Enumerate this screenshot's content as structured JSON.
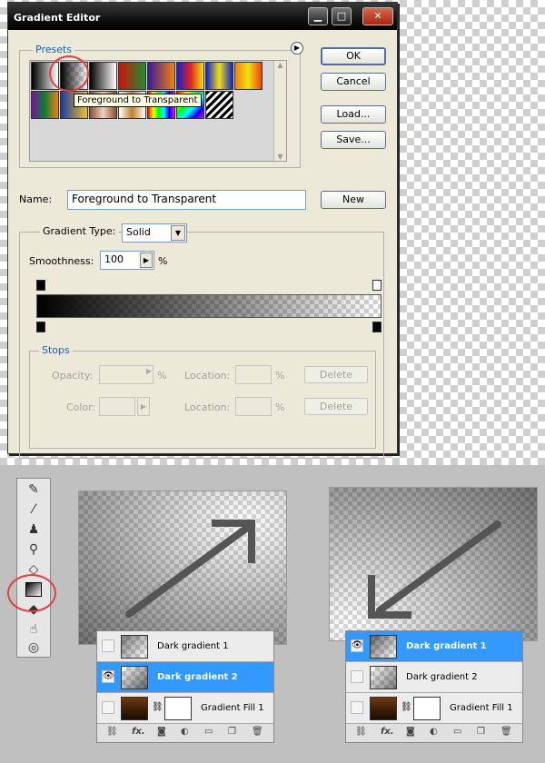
{
  "dialog": {
    "title": "Gradient Editor",
    "presets_label": "Presets",
    "tooltip": "Foreground to Transparent",
    "buttons": {
      "ok": "OK",
      "cancel": "Cancel",
      "load": "Load...",
      "save": "Save...",
      "new": "New"
    },
    "name_label": "Name:",
    "name_value": "Foreground to Transparent",
    "gradient_type_label": "Gradient Type:",
    "gradient_type_value": "Solid",
    "smoothness_label": "Smoothness:",
    "smoothness_value": "100",
    "percent": "%",
    "stops": {
      "label": "Stops",
      "opacity_label": "Opacity:",
      "location_label": "Location:",
      "color_label": "Color:",
      "delete_label": "Delete"
    }
  },
  "layers_left": [
    {
      "name": "Dark gradient 1",
      "selected": false,
      "eye": false
    },
    {
      "name": "Dark gradient 2",
      "selected": true,
      "eye": true
    },
    {
      "name": "Gradient Fill 1",
      "selected": false,
      "eye": false
    }
  ],
  "layers_right": [
    {
      "name": "Dark gradient 1",
      "selected": true,
      "eye": true
    },
    {
      "name": "Dark gradient 2",
      "selected": false,
      "eye": false
    },
    {
      "name": "Gradient Fill 1",
      "selected": false,
      "eye": false
    }
  ],
  "colors": {
    "accent_blue": "#3399ff",
    "highlight_red": "#e04040",
    "legend_blue": "#1a5fb4"
  }
}
